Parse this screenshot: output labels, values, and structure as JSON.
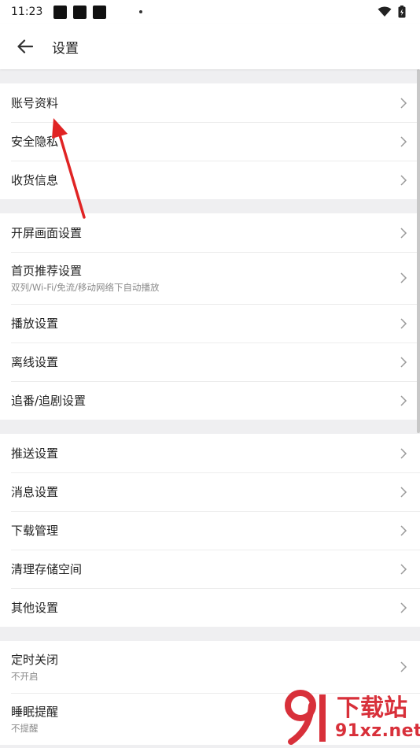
{
  "status_bar": {
    "time": "11:23"
  },
  "header": {
    "title": "设置"
  },
  "groups": [
    {
      "items": [
        {
          "label": "账号资料"
        },
        {
          "label": "安全隐私"
        },
        {
          "label": "收货信息"
        }
      ]
    },
    {
      "items": [
        {
          "label": "开屏画面设置"
        },
        {
          "label": "首页推荐设置",
          "sub": "双列/Wi-Fi/免流/移动网络下自动播放"
        },
        {
          "label": "播放设置"
        },
        {
          "label": "离线设置"
        },
        {
          "label": "追番/追剧设置"
        }
      ]
    },
    {
      "items": [
        {
          "label": "推送设置"
        },
        {
          "label": "消息设置"
        },
        {
          "label": "下载管理"
        },
        {
          "label": "清理存储空间"
        },
        {
          "label": "其他设置"
        }
      ]
    },
    {
      "items": [
        {
          "label": "定时关闭",
          "sub": "不开启"
        },
        {
          "label": "睡眠提醒",
          "sub": "不提醒"
        }
      ]
    }
  ],
  "watermark": {
    "brand": "下载站",
    "domain": "91xz.net"
  },
  "colors": {
    "annotation_arrow": "#e02424",
    "watermark": "#d8303a"
  }
}
